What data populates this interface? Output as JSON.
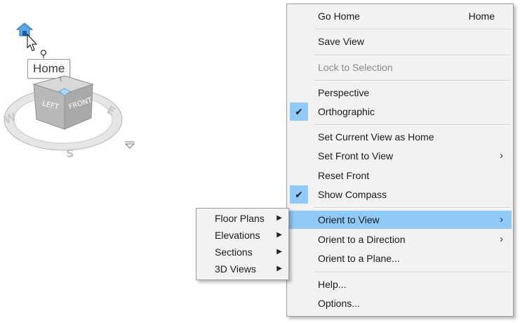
{
  "tooltip": {
    "text": "Home"
  },
  "viewcube": {
    "faces": {
      "left": "LEFT",
      "front": "FRONT",
      "top_hint": "T"
    },
    "compass": {
      "west": "W",
      "south": "S",
      "east": "E"
    }
  },
  "context_menu": {
    "items": [
      {
        "label": "Go Home",
        "shortcut": "Home"
      },
      {
        "label": "Save View"
      },
      {
        "label": "Lock to Selection",
        "disabled": true
      },
      {
        "label": "Perspective"
      },
      {
        "label": "Orthographic",
        "checked": true
      },
      {
        "label": "Set Current View as Home"
      },
      {
        "label": "Set Front to View",
        "submenu": true
      },
      {
        "label": "Reset Front"
      },
      {
        "label": "Show Compass",
        "checked": true
      },
      {
        "label": "Orient to View",
        "submenu": true,
        "highlighted": true
      },
      {
        "label": "Orient to a Direction",
        "submenu": true
      },
      {
        "label": "Orient to a Plane..."
      },
      {
        "label": "Help..."
      },
      {
        "label": "Options..."
      }
    ]
  },
  "submenu": {
    "items": [
      {
        "label": "Floor Plans"
      },
      {
        "label": "Elevations"
      },
      {
        "label": "Sections"
      },
      {
        "label": "3D Views"
      }
    ]
  },
  "icons": {
    "check": "✔",
    "submenu_arrow": "›",
    "submenu_arrow_small": "▶"
  },
  "colors": {
    "menu_bg": "#f2f2f2",
    "highlight": "#91c9f7",
    "home_icon": "#3d8fd6"
  }
}
